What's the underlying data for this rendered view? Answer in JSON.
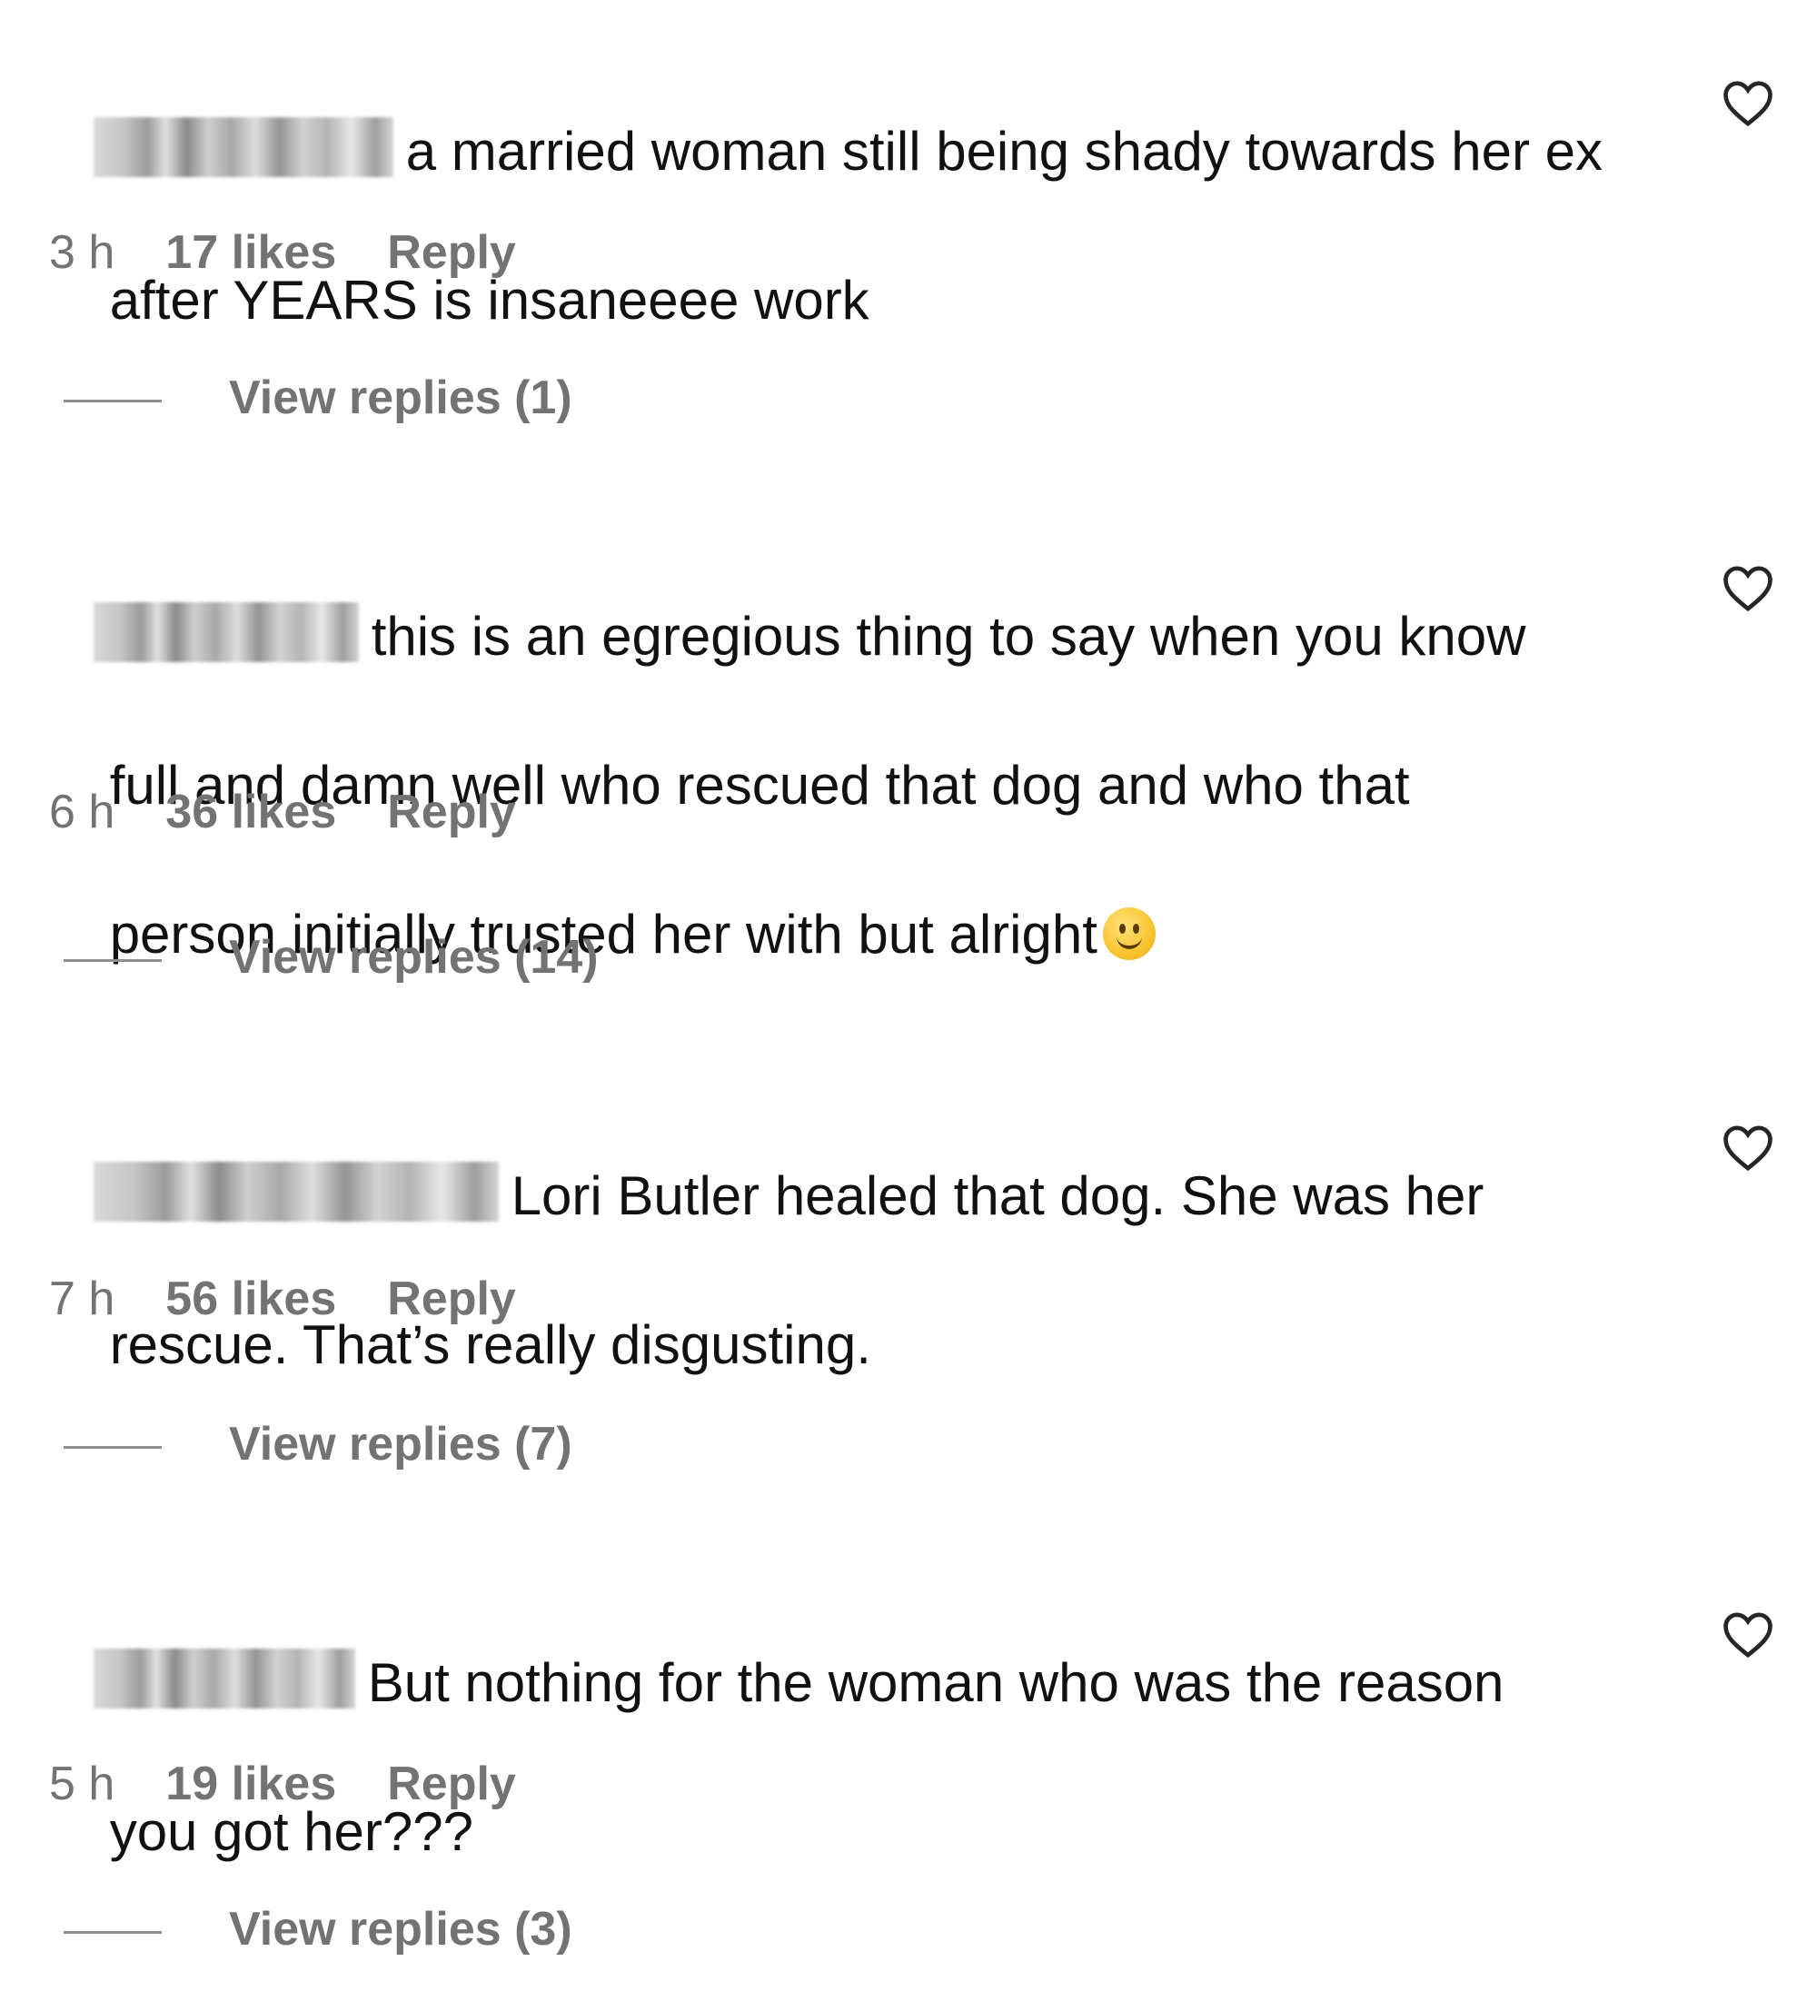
{
  "comments": [
    {
      "text_line1": "a married woman still being shady towards her ex",
      "text_line2": "after YEARS is insaneeee work",
      "time": "3 h",
      "likes": "17 likes",
      "reply": "Reply",
      "view_replies": "View replies (1)"
    },
    {
      "text_line1": "this is an egregious thing to say when you know",
      "text_line2": "full and damn well who rescued that dog and who that",
      "text_line3": "person initially trusted her with but alright",
      "emoji": "slightly-smiling-face-icon",
      "time": "6 h",
      "likes": "36 likes",
      "reply": "Reply",
      "view_replies": "View replies (14)"
    },
    {
      "text_line1": "Lori Butler healed that dog. She was her",
      "text_line2": "rescue. That’s really disgusting.",
      "time": "7 h",
      "likes": "56 likes",
      "reply": "Reply",
      "view_replies": "View replies (7)"
    },
    {
      "text_line1": "But nothing for the woman who was the reason",
      "text_line2": "you got her???",
      "time": "5 h",
      "likes": "19 likes",
      "reply": "Reply",
      "view_replies": "View replies (3)"
    }
  ],
  "colors": {
    "text": "#111111",
    "meta": "#737373",
    "background": "#ffffff"
  }
}
